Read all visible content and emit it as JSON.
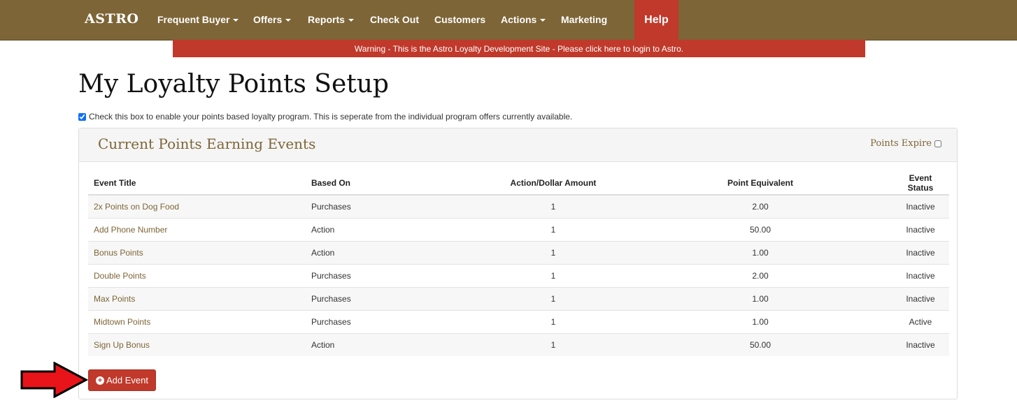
{
  "nav": {
    "brand": "ASTRO",
    "items": [
      {
        "label": "Frequent Buyer",
        "dropdown": true
      },
      {
        "label": "Offers",
        "dropdown": true
      },
      {
        "label": "Reports",
        "dropdown": true
      },
      {
        "label": "Check Out",
        "dropdown": false
      },
      {
        "label": "Customers",
        "dropdown": false
      },
      {
        "label": "Actions",
        "dropdown": true
      },
      {
        "label": "Marketing",
        "dropdown": false
      }
    ],
    "help": "Help"
  },
  "warning": "Warning - This is the Astro Loyalty Development Site - Please click here to login to Astro.",
  "page_title": "My Loyalty Points Setup",
  "enable_checkbox": {
    "checked": true,
    "label": "Check this box to enable your points based loyalty program. This is seperate from the individual program offers currently available."
  },
  "panel": {
    "title": "Current Points Earning Events",
    "expire_label": "Points Expire",
    "expire_checked": false
  },
  "table": {
    "headers": [
      "Event Title",
      "Based On",
      "Action/Dollar Amount",
      "Point Equivalent",
      "Event Status"
    ],
    "rows": [
      [
        "2x Points on Dog Food",
        "Purchases",
        "1",
        "2.00",
        "Inactive"
      ],
      [
        "Add Phone Number",
        "Action",
        "1",
        "50.00",
        "Inactive"
      ],
      [
        "Bonus Points",
        "Action",
        "1",
        "1.00",
        "Inactive"
      ],
      [
        "Double Points",
        "Purchases",
        "1",
        "2.00",
        "Inactive"
      ],
      [
        "Max Points",
        "Purchases",
        "1",
        "1.00",
        "Inactive"
      ],
      [
        "Midtown Points",
        "Purchases",
        "1",
        "1.00",
        "Active"
      ],
      [
        "Sign Up Bonus",
        "Action",
        "1",
        "50.00",
        "Inactive"
      ]
    ]
  },
  "add_button": "Add Event",
  "icons": {
    "add": "plus-circle-icon",
    "annotation": "red-arrow-icon"
  },
  "colors": {
    "brand_brown": "#7d6537",
    "accent_red": "#c0392b"
  }
}
